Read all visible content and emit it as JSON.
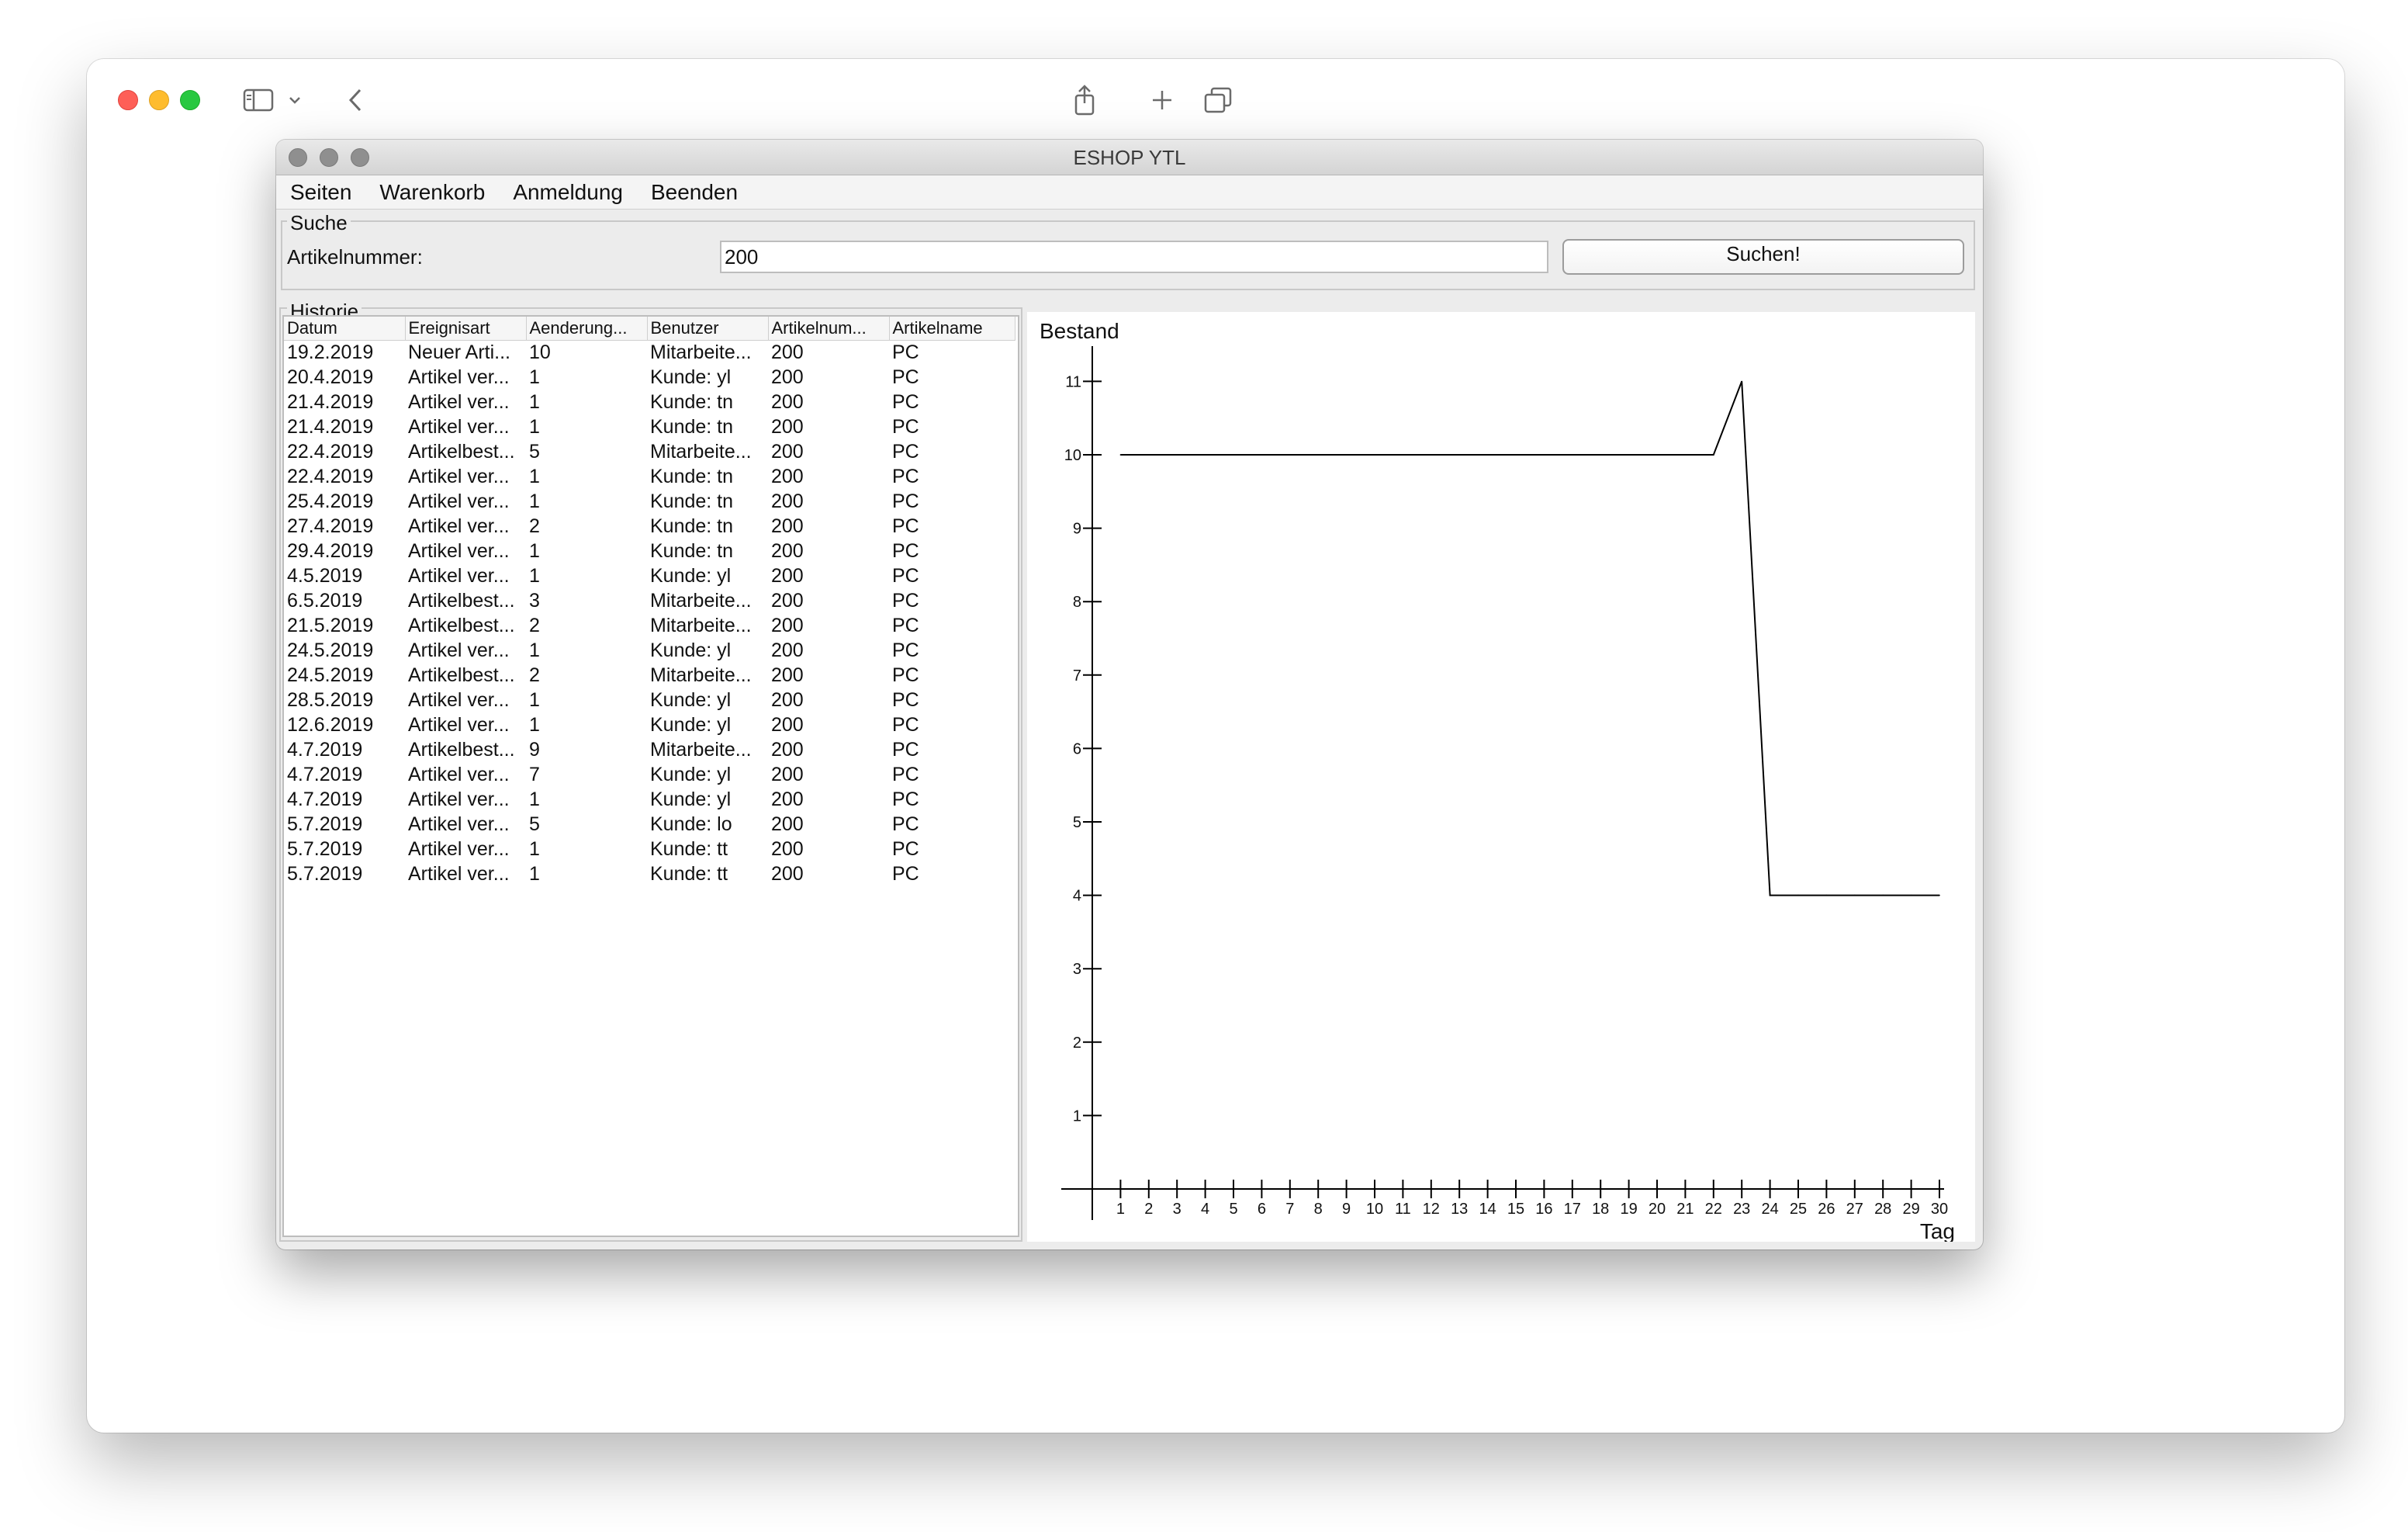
{
  "browser": {
    "icons": [
      "sidebar-icon",
      "chevron-down-icon",
      "back-icon",
      "share-icon",
      "plus-icon",
      "tabs-overview-icon"
    ]
  },
  "app": {
    "title": "ESHOP YTL",
    "menu": [
      "Seiten",
      "Warenkorb",
      "Anmeldung",
      "Beenden"
    ]
  },
  "search": {
    "group_title": "Suche",
    "label": "Artikelnummer:",
    "value": "200",
    "button_label": "Suchen!"
  },
  "history": {
    "group_title": "Historie",
    "columns": [
      "Datum",
      "Ereignisart",
      "Aenderung...",
      "Benutzer",
      "Artikelnum...",
      "Artikelname"
    ],
    "rows": [
      [
        "19.2.2019",
        "Neuer Arti...",
        "10",
        "Mitarbeite...",
        "200",
        "PC"
      ],
      [
        "20.4.2019",
        "Artikel ver...",
        "1",
        "Kunde: yl",
        "200",
        "PC"
      ],
      [
        "21.4.2019",
        "Artikel ver...",
        "1",
        "Kunde: tn",
        "200",
        "PC"
      ],
      [
        "21.4.2019",
        "Artikel ver...",
        "1",
        "Kunde: tn",
        "200",
        "PC"
      ],
      [
        "22.4.2019",
        "Artikelbest...",
        "5",
        "Mitarbeite...",
        "200",
        "PC"
      ],
      [
        "22.4.2019",
        "Artikel ver...",
        "1",
        "Kunde: tn",
        "200",
        "PC"
      ],
      [
        "25.4.2019",
        "Artikel ver...",
        "1",
        "Kunde: tn",
        "200",
        "PC"
      ],
      [
        "27.4.2019",
        "Artikel ver...",
        "2",
        "Kunde: tn",
        "200",
        "PC"
      ],
      [
        "29.4.2019",
        "Artikel ver...",
        "1",
        "Kunde: tn",
        "200",
        "PC"
      ],
      [
        "4.5.2019",
        "Artikel ver...",
        "1",
        "Kunde: yl",
        "200",
        "PC"
      ],
      [
        "6.5.2019",
        "Artikelbest...",
        "3",
        "Mitarbeite...",
        "200",
        "PC"
      ],
      [
        "21.5.2019",
        "Artikelbest...",
        "2",
        "Mitarbeite...",
        "200",
        "PC"
      ],
      [
        "24.5.2019",
        "Artikel ver...",
        "1",
        "Kunde: yl",
        "200",
        "PC"
      ],
      [
        "24.5.2019",
        "Artikelbest...",
        "2",
        "Mitarbeite...",
        "200",
        "PC"
      ],
      [
        "28.5.2019",
        "Artikel ver...",
        "1",
        "Kunde: yl",
        "200",
        "PC"
      ],
      [
        "12.6.2019",
        "Artikel ver...",
        "1",
        "Kunde: yl",
        "200",
        "PC"
      ],
      [
        "4.7.2019",
        "Artikelbest...",
        "9",
        "Mitarbeite...",
        "200",
        "PC"
      ],
      [
        "4.7.2019",
        "Artikel ver...",
        "7",
        "Kunde: yl",
        "200",
        "PC"
      ],
      [
        "4.7.2019",
        "Artikel ver...",
        "1",
        "Kunde: yl",
        "200",
        "PC"
      ],
      [
        "5.7.2019",
        "Artikel ver...",
        "5",
        "Kunde: lo",
        "200",
        "PC"
      ],
      [
        "5.7.2019",
        "Artikel ver...",
        "1",
        "Kunde: tt",
        "200",
        "PC"
      ],
      [
        "5.7.2019",
        "Artikel ver...",
        "1",
        "Kunde: tt",
        "200",
        "PC"
      ]
    ]
  },
  "chart_data": {
    "type": "line",
    "title": "",
    "ylabel": "Bestand",
    "xlabel": "Tag",
    "x": [
      1,
      2,
      3,
      4,
      5,
      6,
      7,
      8,
      9,
      10,
      11,
      12,
      13,
      14,
      15,
      16,
      17,
      18,
      19,
      20,
      21,
      22,
      23,
      24,
      25,
      26,
      27,
      28,
      29,
      30
    ],
    "series": [
      {
        "values": [
          10,
          10,
          10,
          10,
          10,
          10,
          10,
          10,
          10,
          10,
          10,
          10,
          10,
          10,
          10,
          10,
          10,
          10,
          10,
          10,
          10,
          10,
          11,
          4,
          4,
          4,
          4,
          4,
          4,
          4
        ]
      }
    ],
    "xlim": [
      0,
      30
    ],
    "ylim": [
      0,
      11
    ],
    "yticks": [
      1,
      2,
      3,
      4,
      5,
      6,
      7,
      8,
      9,
      10,
      11
    ],
    "grid": false,
    "line_color": "#000000"
  }
}
